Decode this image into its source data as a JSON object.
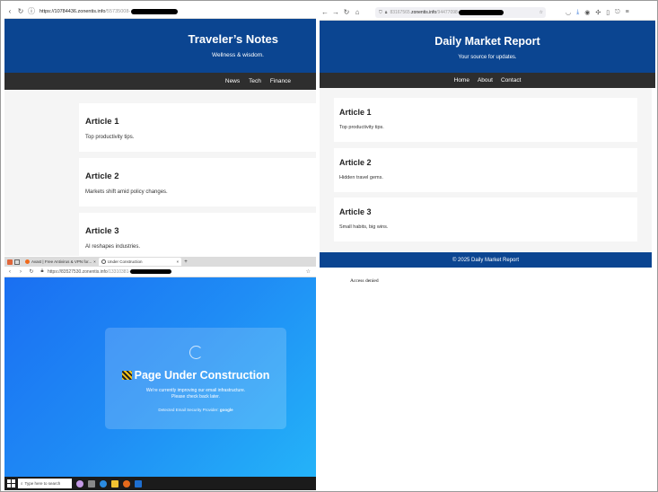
{
  "left_top": {
    "url_domain": "https://10784436.zonentis.info",
    "url_path": "/55735008-",
    "site_title": "Traveler’s Notes",
    "tagline": "Wellness & wisdom.",
    "nav": [
      "News",
      "Tech",
      "Finance"
    ],
    "articles": [
      {
        "title": "Article 1",
        "text": "Top productivity tips."
      },
      {
        "title": "Article 2",
        "text": "Markets shift amid policy changes."
      },
      {
        "title": "Article 3",
        "text": "AI reshapes industries."
      }
    ]
  },
  "left_bottom": {
    "tabs": [
      {
        "label": "Avast | Free Antivirus & VPN for..."
      },
      {
        "label": "Under Construction"
      }
    ],
    "url_domain": "https://83527530.zonentis.info",
    "url_path": "/13310381-",
    "heading": "Page Under Construction",
    "message_line1": "We're currently improving our email infrastructure.",
    "message_line2": "Please check back later.",
    "provider_label": "Detected Email Security Provider:",
    "provider_value": "google",
    "taskbar_search": "Type here to search"
  },
  "right": {
    "url_domain": "zonentis.info",
    "url_prefix": "83167565.",
    "url_path": "/94477098-",
    "site_title": "Daily Market Report",
    "tagline": "Your source for updates.",
    "nav": [
      "Home",
      "About",
      "Contact"
    ],
    "articles": [
      {
        "title": "Article 1",
        "text": "Top productivity tips."
      },
      {
        "title": "Article 2",
        "text": "Hidden travel gems."
      },
      {
        "title": "Article 3",
        "text": "Small habits, big wins."
      }
    ],
    "footer": "© 2025 Daily Market Report",
    "access_denied": "Access denied"
  },
  "colors": {
    "header_blue": "#0b4591",
    "nav_dark": "#2e2e2e",
    "construction_gradient_start": "#1a6ff2",
    "construction_gradient_end": "#24b3f8"
  },
  "icons": [
    "back-icon",
    "forward-icon",
    "reload-icon",
    "home-icon",
    "lock-icon",
    "star-icon",
    "spinner-icon",
    "construction-icon",
    "windows-start-icon",
    "search-icon"
  ]
}
